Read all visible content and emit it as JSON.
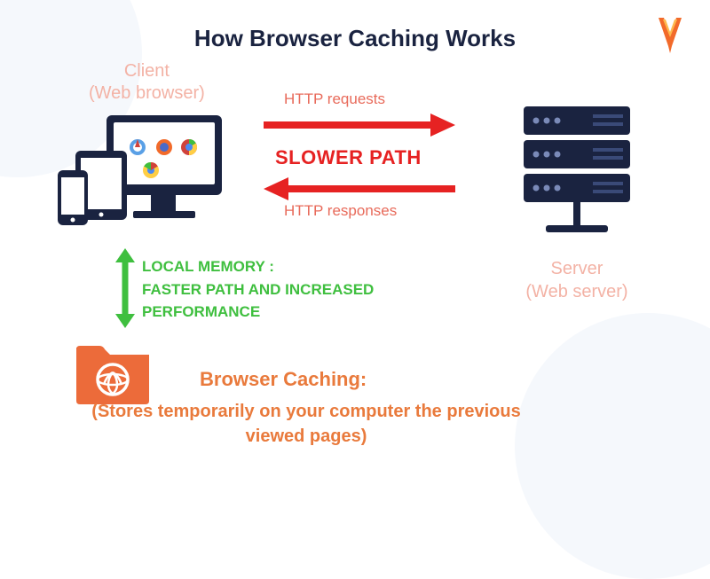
{
  "title": "How Browser Caching Works",
  "client": {
    "line1": "Client",
    "line2": "(Web browser)"
  },
  "server": {
    "line1": "Server",
    "line2": "(Web server)"
  },
  "http_requests": "HTTP requests",
  "http_responses": "HTTP responses",
  "slower_path": "SLOWER PATH",
  "local_memory": {
    "line1": "LOCAL MEMORY :",
    "line2": "FASTER PATH AND INCREASED",
    "line3": "PERFORMANCE"
  },
  "caching": {
    "title": "Browser Caching:",
    "desc": "(Stores temporarily on your computer the previous viewed pages)"
  },
  "colors": {
    "navy": "#1a2340",
    "red": "#e62222",
    "green": "#3fbf3f",
    "orange": "#e97a3c",
    "salmon": "#e86a5a"
  }
}
